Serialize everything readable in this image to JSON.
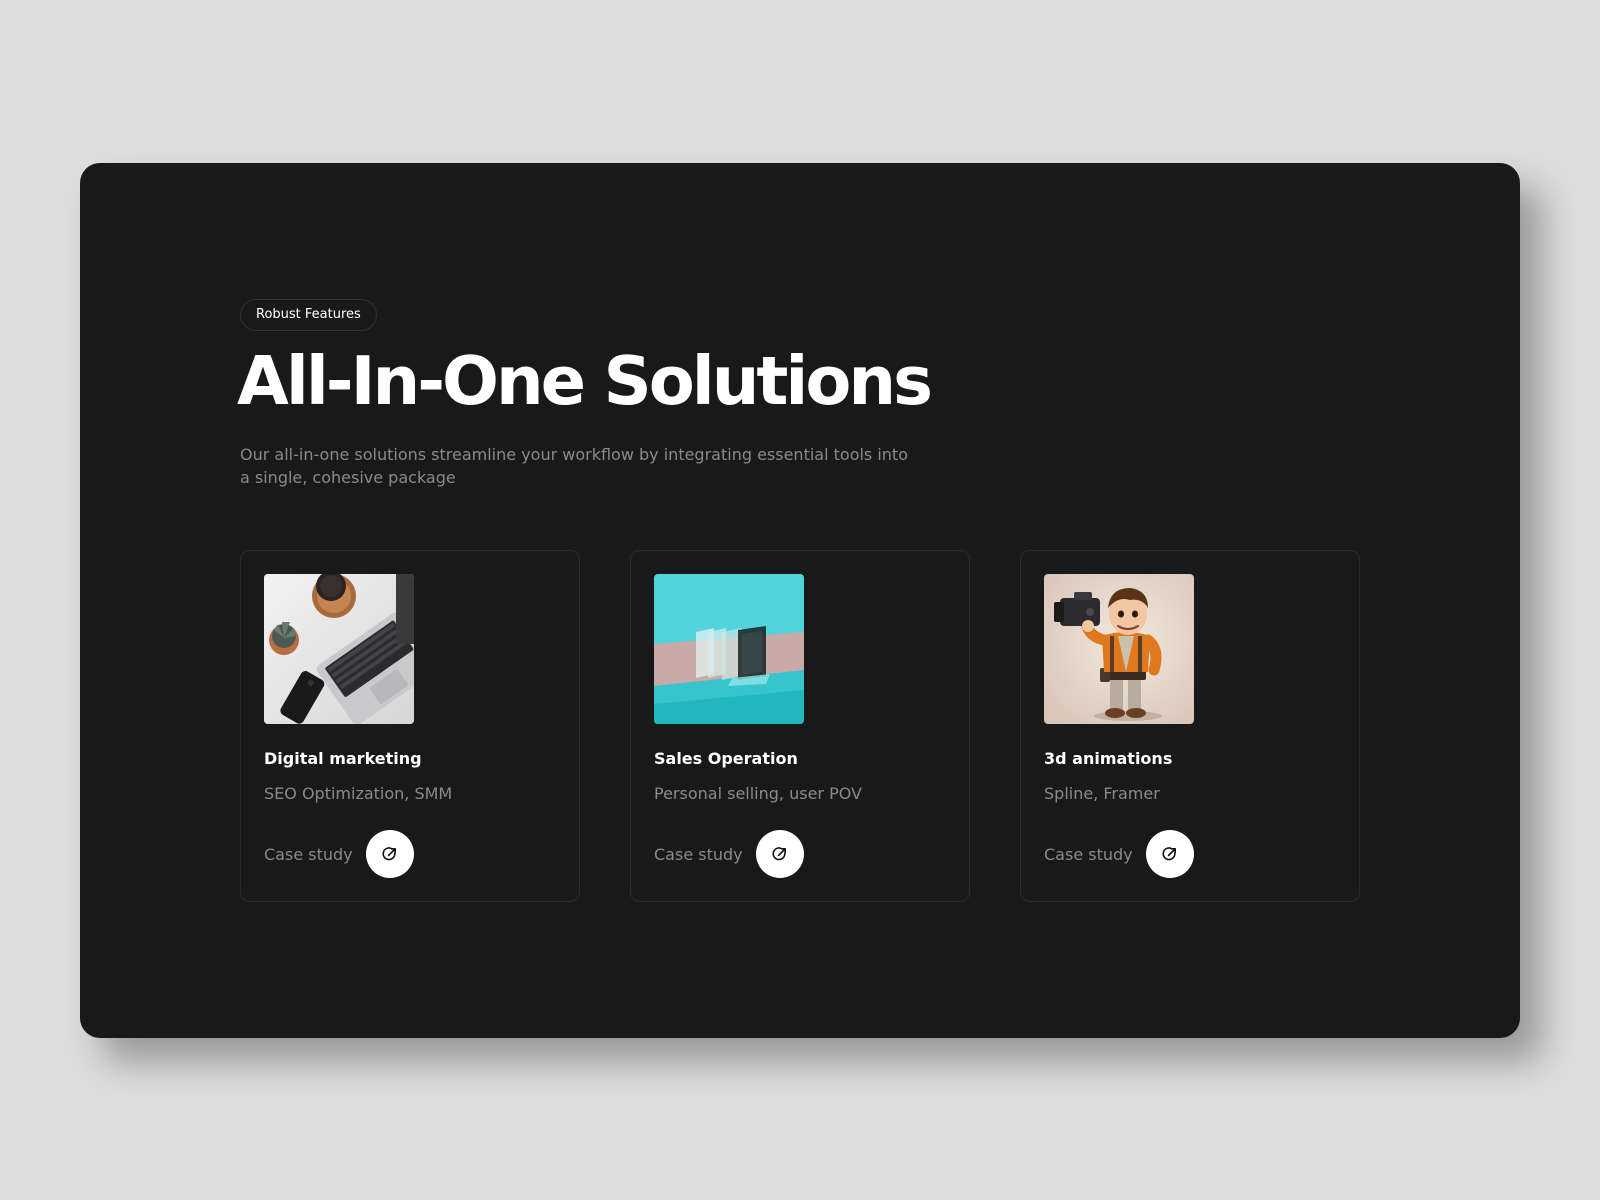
{
  "section": {
    "badge": "Robust Features",
    "title": "All-In-One Solutions",
    "subtitle": "Our all-in-one solutions streamline your workflow by integrating essential tools into a single, cohesive package"
  },
  "cards": [
    {
      "title": "Digital marketing",
      "subtitle": "SEO Optimization, SMM",
      "link_label": "Case study",
      "image": "laptop-desk-photo",
      "link_icon": "arrow-up-right-icon"
    },
    {
      "title": "Sales Operation",
      "subtitle": "Personal selling, user POV",
      "link_label": "Case study",
      "image": "glass-panels-render",
      "link_icon": "arrow-up-right-icon"
    },
    {
      "title": "3d animations",
      "subtitle": "Spline, Framer",
      "link_label": "Case study",
      "image": "cartoon-cameraman-render",
      "link_icon": "arrow-up-right-icon"
    }
  ],
  "colors": {
    "page_background": "#dcdcdc",
    "panel_background": "#191919",
    "text_primary": "#ffffff",
    "text_muted": "#8a8a8a",
    "card_border": "#2c2c2c",
    "button_background": "#ffffff"
  }
}
